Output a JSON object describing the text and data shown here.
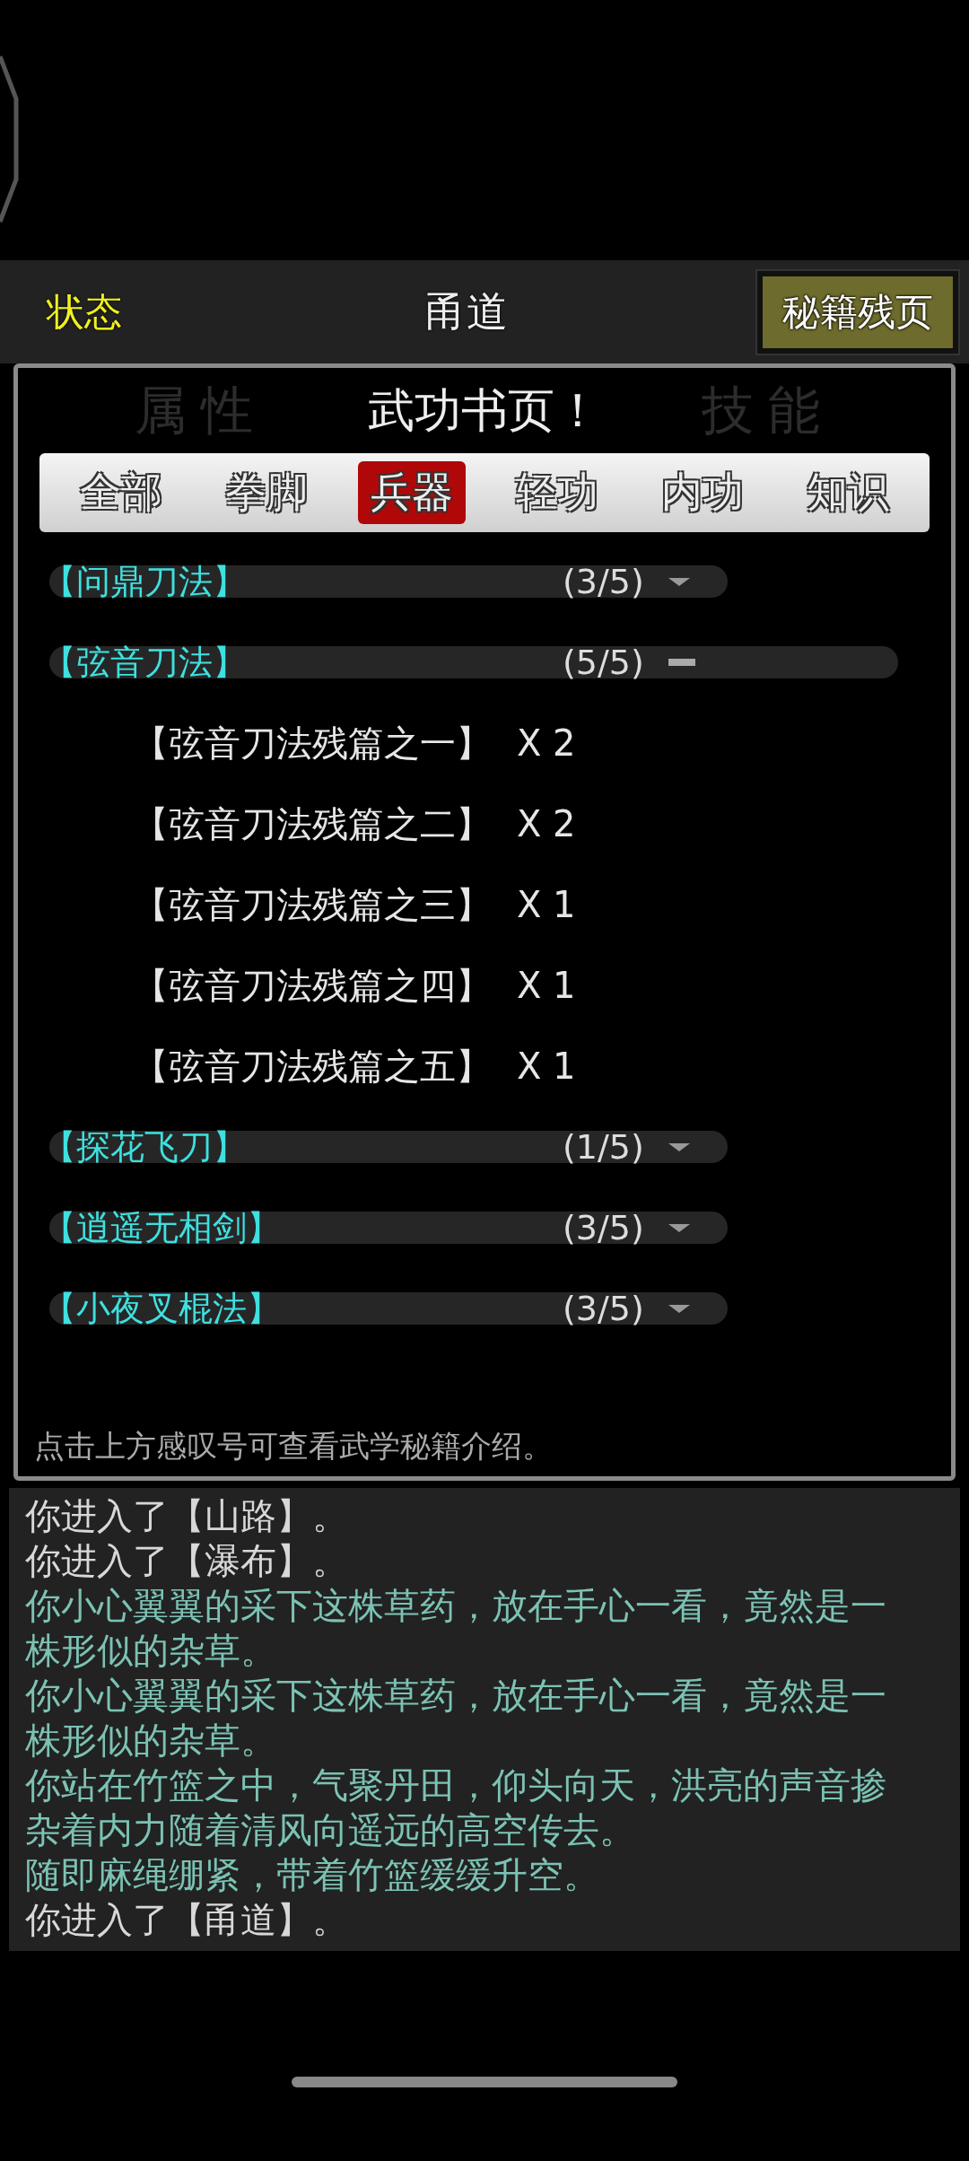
{
  "header": {
    "status_label": "状态",
    "location": "甬道",
    "manual_button": "秘籍残页"
  },
  "popup": {
    "title": "武功书页！",
    "backdrop_tabs": [
      "属性",
      "技能"
    ],
    "tabs": [
      {
        "label": "全部",
        "selected": false
      },
      {
        "label": "拳脚",
        "selected": false
      },
      {
        "label": "兵器",
        "selected": true
      },
      {
        "label": "轻功",
        "selected": false
      },
      {
        "label": "内功",
        "selected": false
      },
      {
        "label": "知识",
        "selected": false
      }
    ],
    "groups": [
      {
        "name": "【问鼎刀法】",
        "count": "(3/5)",
        "expanded": false
      },
      {
        "name": "【弦音刀法】",
        "count": "(5/5)",
        "expanded": true,
        "children": [
          {
            "name": "【弦音刀法残篇之一】",
            "qty": "X 2"
          },
          {
            "name": "【弦音刀法残篇之二】",
            "qty": "X 2"
          },
          {
            "name": "【弦音刀法残篇之三】",
            "qty": "X 1"
          },
          {
            "name": "【弦音刀法残篇之四】",
            "qty": "X 1"
          },
          {
            "name": "【弦音刀法残篇之五】",
            "qty": "X 1"
          }
        ]
      },
      {
        "name": "【探花飞刀】",
        "count": "(1/5)",
        "expanded": false
      },
      {
        "name": "【逍遥无相剑】",
        "count": "(3/5)",
        "expanded": false
      },
      {
        "name": "【小夜叉棍法】",
        "count": "(3/5)",
        "expanded": false
      }
    ],
    "hint": "点击上方感叹号可查看武学秘籍介绍。"
  },
  "log": [
    {
      "text": "你进入了【山路】。",
      "kind": "system"
    },
    {
      "text": "你进入了【瀑布】。",
      "kind": "system"
    },
    {
      "text": "你小心翼翼的采下这株草药，放在手心一看，竟然是一株形似的杂草。",
      "kind": "event"
    },
    {
      "text": "你小心翼翼的采下这株草药，放在手心一看，竟然是一株形似的杂草。",
      "kind": "event"
    },
    {
      "text": "你站在竹篮之中，气聚丹田，仰头向天，洪亮的声音掺杂着内力随着清风向遥远的高空传去。",
      "kind": "event"
    },
    {
      "text": "随即麻绳绷紧，带着竹篮缓缓升空。",
      "kind": "event"
    },
    {
      "text": "你进入了【甬道】。",
      "kind": "system"
    }
  ]
}
